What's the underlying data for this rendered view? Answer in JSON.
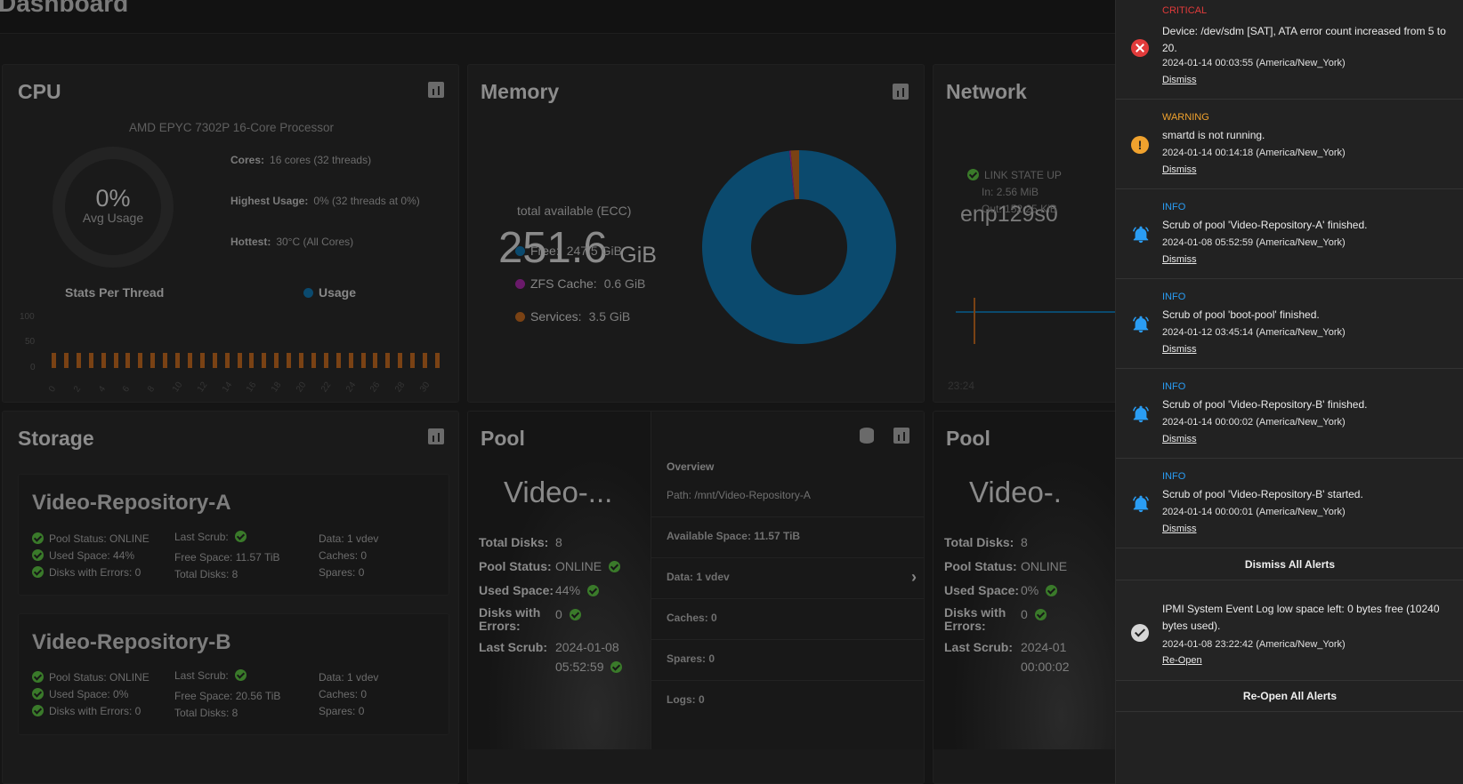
{
  "dashboard": {
    "title": "Dashboard"
  },
  "cpu": {
    "title": "CPU",
    "model": "AMD EPYC 7302P 16-Core Processor",
    "avg_value": "0%",
    "avg_label": "Avg Usage",
    "cores_label": "Cores:",
    "cores_value": "16 cores (32 threads)",
    "highest_label": "Highest Usage:",
    "highest_value": "0%  (32 threads at 0%)",
    "hottest_label": "Hottest:",
    "hottest_value": "30°C  (All Cores)",
    "stats_title": "Stats Per Thread",
    "legend_usage": "Usage",
    "y_ticks": [
      "100",
      "50",
      "0"
    ],
    "x_ticks": [
      "0",
      "2",
      "4",
      "6",
      "8",
      "10",
      "12",
      "14",
      "16",
      "18",
      "20",
      "22",
      "24",
      "26",
      "28",
      "30"
    ],
    "thread_count": 32
  },
  "memory": {
    "title": "Memory",
    "total_value": "251.6",
    "total_unit": "GiB",
    "total_sub": "total available (ECC)",
    "free_label": "Free:",
    "free_value": "247.5 GiB",
    "zfs_label": "ZFS Cache:",
    "zfs_value": "0.6 GiB",
    "services_label": "Services:",
    "services_value": "3.5 GiB",
    "colors": {
      "free": "#0b4a6e",
      "zfs": "#6a1a6a",
      "services": "#7a4214"
    },
    "chart_data": {
      "type": "pie",
      "categories": [
        "Free",
        "ZFS Cache",
        "Services"
      ],
      "values": [
        247.5,
        0.6,
        3.5
      ]
    }
  },
  "network": {
    "title": "Network",
    "interface": "enp129s0",
    "link_state": "LINK STATE UP",
    "in_label": "In:",
    "in_value": "2.56 MiB",
    "out_label": "Out:",
    "out_value": "152.25 KiB",
    "time_label": "23:24"
  },
  "storage": {
    "title": "Storage",
    "pools": [
      {
        "name": "Video-Repository-A",
        "pool_status": "Pool Status:  ONLINE",
        "used_space": "Used Space:  44%",
        "disks_errors": "Disks with Errors:  0",
        "last_scrub": "Last Scrub:",
        "free_space": "Free Space:  11.57 TiB",
        "total_disks": "Total Disks:  8",
        "data": "Data:  1 vdev",
        "caches": "Caches:  0",
        "spares": "Spares:  0"
      },
      {
        "name": "Video-Repository-B",
        "pool_status": "Pool Status:  ONLINE",
        "used_space": "Used Space:  0%",
        "disks_errors": "Disks with Errors:  0",
        "last_scrub": "Last Scrub:",
        "free_space": "Free Space:  20.56 TiB",
        "total_disks": "Total Disks:  8",
        "data": "Data:  1 vdev",
        "caches": "Caches:  0",
        "spares": "Spares:  0"
      }
    ]
  },
  "pool_a": {
    "title": "Pool",
    "big_name": "Video-...",
    "total_disks_label": "Total Disks:",
    "total_disks_value": "8",
    "status_label": "Pool Status:",
    "status_value": "ONLINE",
    "used_label": "Used Space:",
    "used_value": "44%",
    "errors_label_1": "Disks with",
    "errors_label_2": "Errors:",
    "errors_value": "0",
    "scrub_label": "Last Scrub:",
    "scrub_date": "2024-01-08",
    "scrub_time": "05:52:59",
    "overview": {
      "heading": "Overview",
      "path": "Path:  /mnt/Video-Repository-A",
      "available": "Available Space:  11.57  TiB",
      "data": "Data:  1 vdev",
      "caches": "Caches:  0",
      "spares": "Spares:  0",
      "logs": "Logs:  0"
    }
  },
  "pool_b": {
    "title": "Pool",
    "big_name": "Video-.",
    "total_disks_label": "Total Disks:",
    "total_disks_value": "8",
    "status_label": "Pool Status:",
    "status_value": "ONLINE",
    "used_label": "Used Space:",
    "used_value": "0%",
    "errors_label_1": "Disks with",
    "errors_label_2": "Errors:",
    "errors_value": "0",
    "scrub_label": "Last Scrub:",
    "scrub_date": "2024-01",
    "scrub_time": "00:00:02"
  },
  "alerts": {
    "colors": {
      "critical": "#e23b3b",
      "warning": "#f0a22e",
      "info": "#2a9df4"
    },
    "items": [
      {
        "level": "CRITICAL",
        "message": "Device: /dev/sdm [SAT], ATA error count increased from 5 to 20.",
        "timestamp": "2024-01-14 00:03:55 (America/New_York)",
        "action": "Dismiss",
        "icon": "critical-icon"
      },
      {
        "level": "WARNING",
        "message": "smartd is not running.",
        "timestamp": "2024-01-14 00:14:18 (America/New_York)",
        "action": "Dismiss",
        "icon": "warning-icon"
      },
      {
        "level": "INFO",
        "message": "Scrub of pool 'Video-Repository-A' finished.",
        "timestamp": "2024-01-08 05:52:59 (America/New_York)",
        "action": "Dismiss",
        "icon": "bell-icon"
      },
      {
        "level": "INFO",
        "message": "Scrub of pool 'boot-pool' finished.",
        "timestamp": "2024-01-12 03:45:14 (America/New_York)",
        "action": "Dismiss",
        "icon": "bell-icon"
      },
      {
        "level": "INFO",
        "message": "Scrub of pool 'Video-Repository-B' finished.",
        "timestamp": "2024-01-14 00:00:02 (America/New_York)",
        "action": "Dismiss",
        "icon": "bell-icon"
      },
      {
        "level": "INFO",
        "message": "Scrub of pool 'Video-Repository-B' started.",
        "timestamp": "2024-01-14 00:00:01 (America/New_York)",
        "action": "Dismiss",
        "icon": "bell-icon"
      }
    ],
    "dismiss_all": "Dismiss All Alerts",
    "dismissed": {
      "message": "IPMI System Event Log low space left: 0 bytes free (10240 bytes used).",
      "timestamp": "2024-01-08 23:22:42 (America/New_York)",
      "action": "Re-Open",
      "icon": "check-circle-icon"
    },
    "reopen_all": "Re-Open All Alerts"
  }
}
